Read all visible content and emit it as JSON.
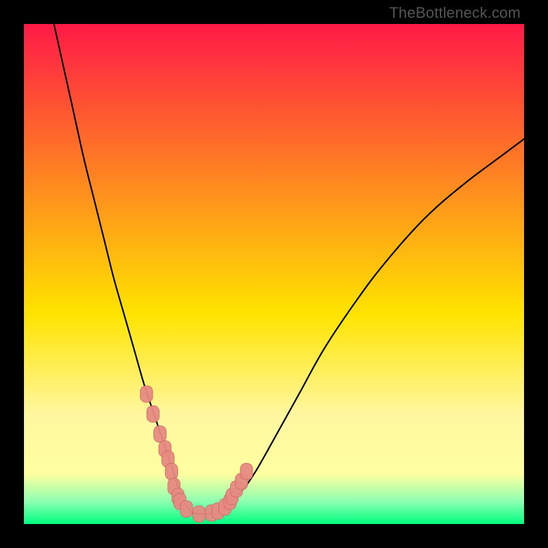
{
  "watermark": "TheBottleneck.com",
  "colors": {
    "frame": "#000000",
    "top": "#ff1a47",
    "mid": "#ffe400",
    "low1": "#fff7a0",
    "low2": "#ffffa0",
    "green1": "#8cffb0",
    "green2": "#00ff80",
    "curve": "#000000",
    "marker_fill": "#e78b82",
    "marker_stroke": "#cf6f67"
  },
  "chart_data": {
    "type": "line",
    "title": "",
    "xlabel": "",
    "ylabel": "",
    "xlim": [
      0,
      100
    ],
    "ylim": [
      0,
      100
    ],
    "grid": false,
    "legend": false,
    "series": [
      {
        "name": "bottleneck-curve",
        "x": [
          6,
          8,
          10,
          12,
          14,
          16,
          18,
          20,
          22,
          24,
          26,
          28,
          29,
          30,
          31,
          32,
          33,
          34,
          36,
          38,
          40,
          43,
          46,
          50,
          55,
          60,
          66,
          72,
          80,
          88,
          96,
          100
        ],
        "y": [
          100,
          91,
          82,
          73,
          65,
          57,
          49,
          42,
          35,
          28,
          22,
          16,
          13,
          10,
          7,
          4.5,
          3,
          2.2,
          2,
          2.2,
          3.2,
          6,
          10,
          17,
          26,
          35,
          44,
          52,
          61,
          68,
          74,
          77
        ]
      }
    ],
    "markers": {
      "name": "highlighted-points",
      "x": [
        24.5,
        25.8,
        27.2,
        28.2,
        28.8,
        29.5,
        30.0,
        30.8,
        31.2,
        32.5,
        35.0,
        37.5,
        38.8,
        40.2,
        41.2,
        41.6,
        42.5,
        43.5,
        44.5
      ],
      "y": [
        26.0,
        22.0,
        18.0,
        15.0,
        13.0,
        10.5,
        7.5,
        5.5,
        4.5,
        3.0,
        2.0,
        2.2,
        2.6,
        3.4,
        4.5,
        5.5,
        7.0,
        8.5,
        10.5
      ]
    }
  }
}
